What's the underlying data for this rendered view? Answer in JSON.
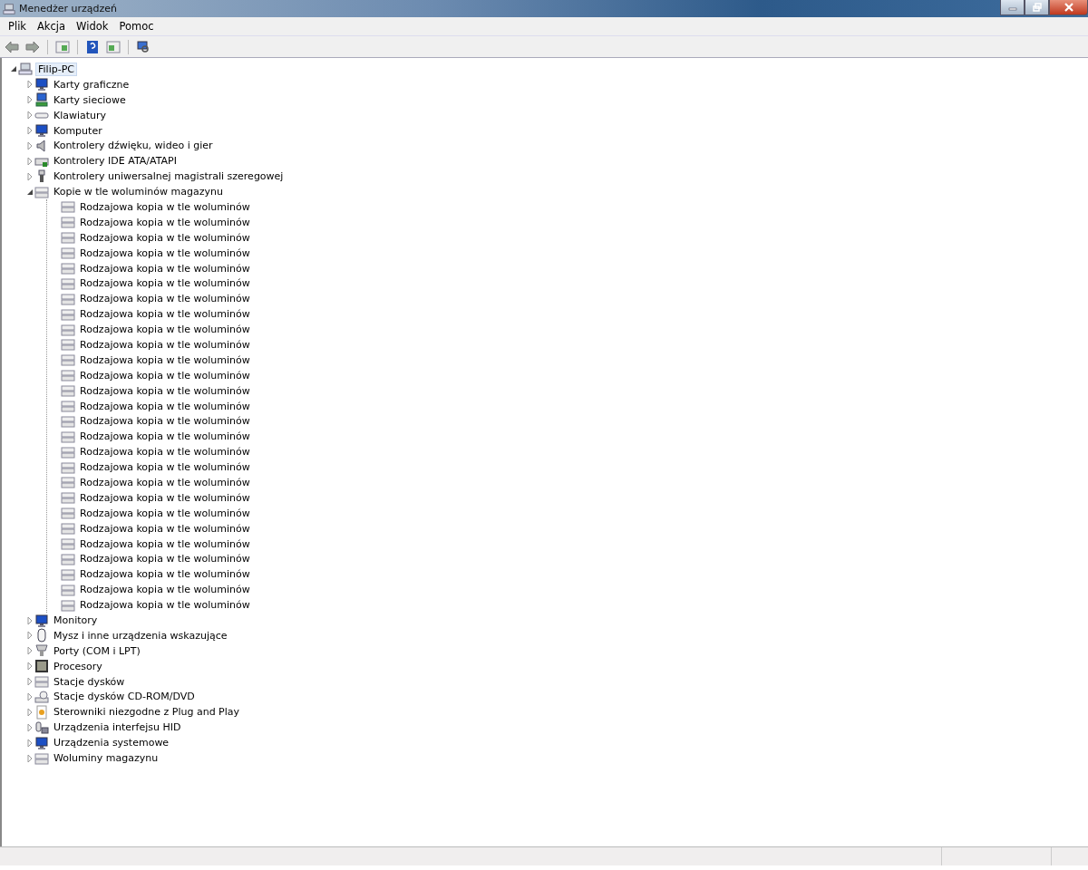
{
  "window": {
    "title": "Menedżer urządzeń"
  },
  "menu": [
    "Plik",
    "Akcja",
    "Widok",
    "Pomoc"
  ],
  "tree": [
    {
      "label": "Filip-PC",
      "kind": "computer-root",
      "selected": true,
      "expanded": true,
      "children": [
        {
          "label": "Karty graficzne",
          "kind": "display",
          "expanded": false
        },
        {
          "label": "Karty sieciowe",
          "kind": "network",
          "expanded": false
        },
        {
          "label": "Klawiatury",
          "kind": "keyboard",
          "expanded": false
        },
        {
          "label": "Komputer",
          "kind": "computer",
          "expanded": false
        },
        {
          "label": "Kontrolery dźwięku, wideo i gier",
          "kind": "sound",
          "expanded": false
        },
        {
          "label": "Kontrolery IDE ATA/ATAPI",
          "kind": "ide",
          "expanded": false
        },
        {
          "label": "Kontrolery uniwersalnej magistrali szeregowej",
          "kind": "usb",
          "expanded": false
        },
        {
          "label": "Kopie w tle woluminów magazynu",
          "kind": "storage",
          "expanded": true,
          "children": [
            {
              "label": "Rodzajowa kopia w tle woluminów",
              "kind": "storage"
            },
            {
              "label": "Rodzajowa kopia w tle woluminów",
              "kind": "storage"
            },
            {
              "label": "Rodzajowa kopia w tle woluminów",
              "kind": "storage"
            },
            {
              "label": "Rodzajowa kopia w tle woluminów",
              "kind": "storage"
            },
            {
              "label": "Rodzajowa kopia w tle woluminów",
              "kind": "storage"
            },
            {
              "label": "Rodzajowa kopia w tle woluminów",
              "kind": "storage"
            },
            {
              "label": "Rodzajowa kopia w tle woluminów",
              "kind": "storage"
            },
            {
              "label": "Rodzajowa kopia w tle woluminów",
              "kind": "storage"
            },
            {
              "label": "Rodzajowa kopia w tle woluminów",
              "kind": "storage"
            },
            {
              "label": "Rodzajowa kopia w tle woluminów",
              "kind": "storage"
            },
            {
              "label": "Rodzajowa kopia w tle woluminów",
              "kind": "storage"
            },
            {
              "label": "Rodzajowa kopia w tle woluminów",
              "kind": "storage"
            },
            {
              "label": "Rodzajowa kopia w tle woluminów",
              "kind": "storage"
            },
            {
              "label": "Rodzajowa kopia w tle woluminów",
              "kind": "storage"
            },
            {
              "label": "Rodzajowa kopia w tle woluminów",
              "kind": "storage"
            },
            {
              "label": "Rodzajowa kopia w tle woluminów",
              "kind": "storage"
            },
            {
              "label": "Rodzajowa kopia w tle woluminów",
              "kind": "storage"
            },
            {
              "label": "Rodzajowa kopia w tle woluminów",
              "kind": "storage"
            },
            {
              "label": "Rodzajowa kopia w tle woluminów",
              "kind": "storage"
            },
            {
              "label": "Rodzajowa kopia w tle woluminów",
              "kind": "storage"
            },
            {
              "label": "Rodzajowa kopia w tle woluminów",
              "kind": "storage"
            },
            {
              "label": "Rodzajowa kopia w tle woluminów",
              "kind": "storage"
            },
            {
              "label": "Rodzajowa kopia w tle woluminów",
              "kind": "storage"
            },
            {
              "label": "Rodzajowa kopia w tle woluminów",
              "kind": "storage"
            },
            {
              "label": "Rodzajowa kopia w tle woluminów",
              "kind": "storage"
            },
            {
              "label": "Rodzajowa kopia w tle woluminów",
              "kind": "storage"
            },
            {
              "label": "Rodzajowa kopia w tle woluminów",
              "kind": "storage"
            }
          ]
        },
        {
          "label": "Monitory",
          "kind": "display",
          "expanded": false
        },
        {
          "label": "Mysz i inne urządzenia wskazujące",
          "kind": "mouse",
          "expanded": false
        },
        {
          "label": "Porty (COM i LPT)",
          "kind": "port",
          "expanded": false
        },
        {
          "label": "Procesory",
          "kind": "cpu",
          "expanded": false
        },
        {
          "label": "Stacje dysków",
          "kind": "disk",
          "expanded": false
        },
        {
          "label": "Stacje dysków CD-ROM/DVD",
          "kind": "cdrom",
          "expanded": false
        },
        {
          "label": "Sterowniki niezgodne z Plug and Play",
          "kind": "unknown",
          "expanded": false
        },
        {
          "label": "Urządzenia interfejsu HID",
          "kind": "hid",
          "expanded": false
        },
        {
          "label": "Urządzenia systemowe",
          "kind": "computer",
          "expanded": false
        },
        {
          "label": "Woluminy magazynu",
          "kind": "disk",
          "expanded": false
        }
      ]
    }
  ]
}
